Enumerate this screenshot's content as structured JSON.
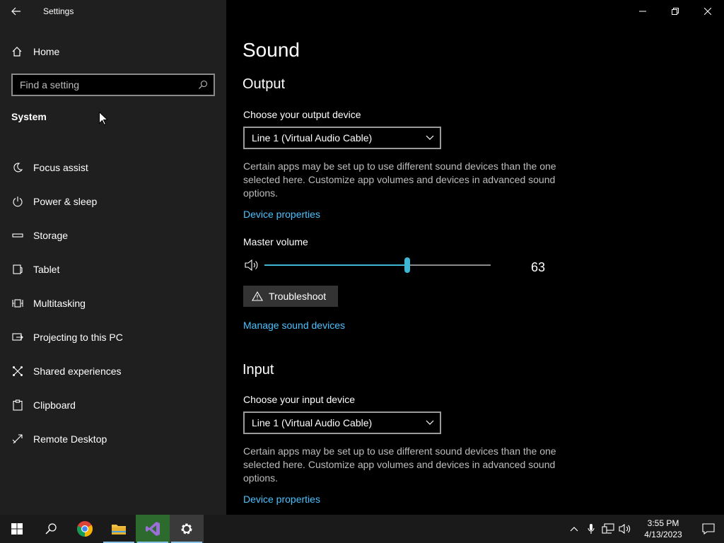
{
  "window": {
    "title": "Settings"
  },
  "sidebar": {
    "home_label": "Home",
    "search_placeholder": "Find a setting",
    "section_title": "System",
    "items": [
      {
        "label": "Focus assist",
        "icon": "moon-icon"
      },
      {
        "label": "Power & sleep",
        "icon": "power-icon"
      },
      {
        "label": "Storage",
        "icon": "storage-icon"
      },
      {
        "label": "Tablet",
        "icon": "tablet-icon"
      },
      {
        "label": "Multitasking",
        "icon": "multitasking-icon"
      },
      {
        "label": "Projecting to this PC",
        "icon": "projecting-icon"
      },
      {
        "label": "Shared experiences",
        "icon": "shared-experiences-icon"
      },
      {
        "label": "Clipboard",
        "icon": "clipboard-icon"
      },
      {
        "label": "Remote Desktop",
        "icon": "remote-desktop-icon"
      }
    ]
  },
  "main": {
    "page_title": "Sound",
    "output": {
      "title": "Output",
      "device_label": "Choose your output device",
      "device_value": "Line 1 (Virtual Audio Cable)",
      "description": "Certain apps may be set up to use different sound devices than the one selected here. Customize app volumes and devices in advanced sound options.",
      "device_properties_link": "Device properties",
      "master_volume_label": "Master volume",
      "master_volume_value": "63",
      "volume_fraction": 0.63,
      "troubleshoot_label": "Troubleshoot",
      "manage_link": "Manage sound devices"
    },
    "input": {
      "title": "Input",
      "device_label": "Choose your input device",
      "device_value": "Line 1 (Virtual Audio Cable)",
      "description": "Certain apps may be set up to use different sound devices than the one selected here. Customize app volumes and devices in advanced sound options.",
      "device_properties_link": "Device properties"
    }
  },
  "taskbar": {
    "time": "3:55 PM",
    "date": "4/13/2023"
  },
  "colors": {
    "accent": "#3fb6d4",
    "link": "#4cc2ff",
    "sidebar_bg": "#1f1f1f",
    "main_bg": "#000000"
  }
}
